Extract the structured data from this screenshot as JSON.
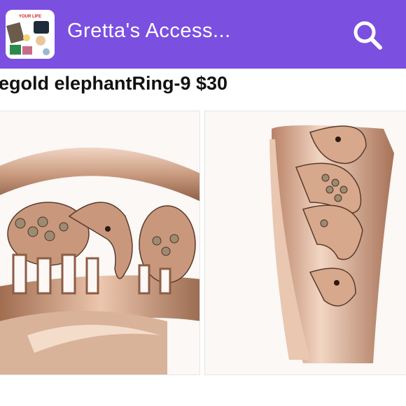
{
  "header": {
    "app_title": "Gretta's Access...",
    "app_icon": "store-logo-icon",
    "search_icon": "search-icon",
    "accent_color": "#7b4fe0",
    "logo_text": "YOUR LIFE"
  },
  "listing": {
    "title": "egold elephantRing-9 $30"
  },
  "photos": [
    {
      "name": "ring-front-photo"
    },
    {
      "name": "ring-side-photo"
    }
  ]
}
